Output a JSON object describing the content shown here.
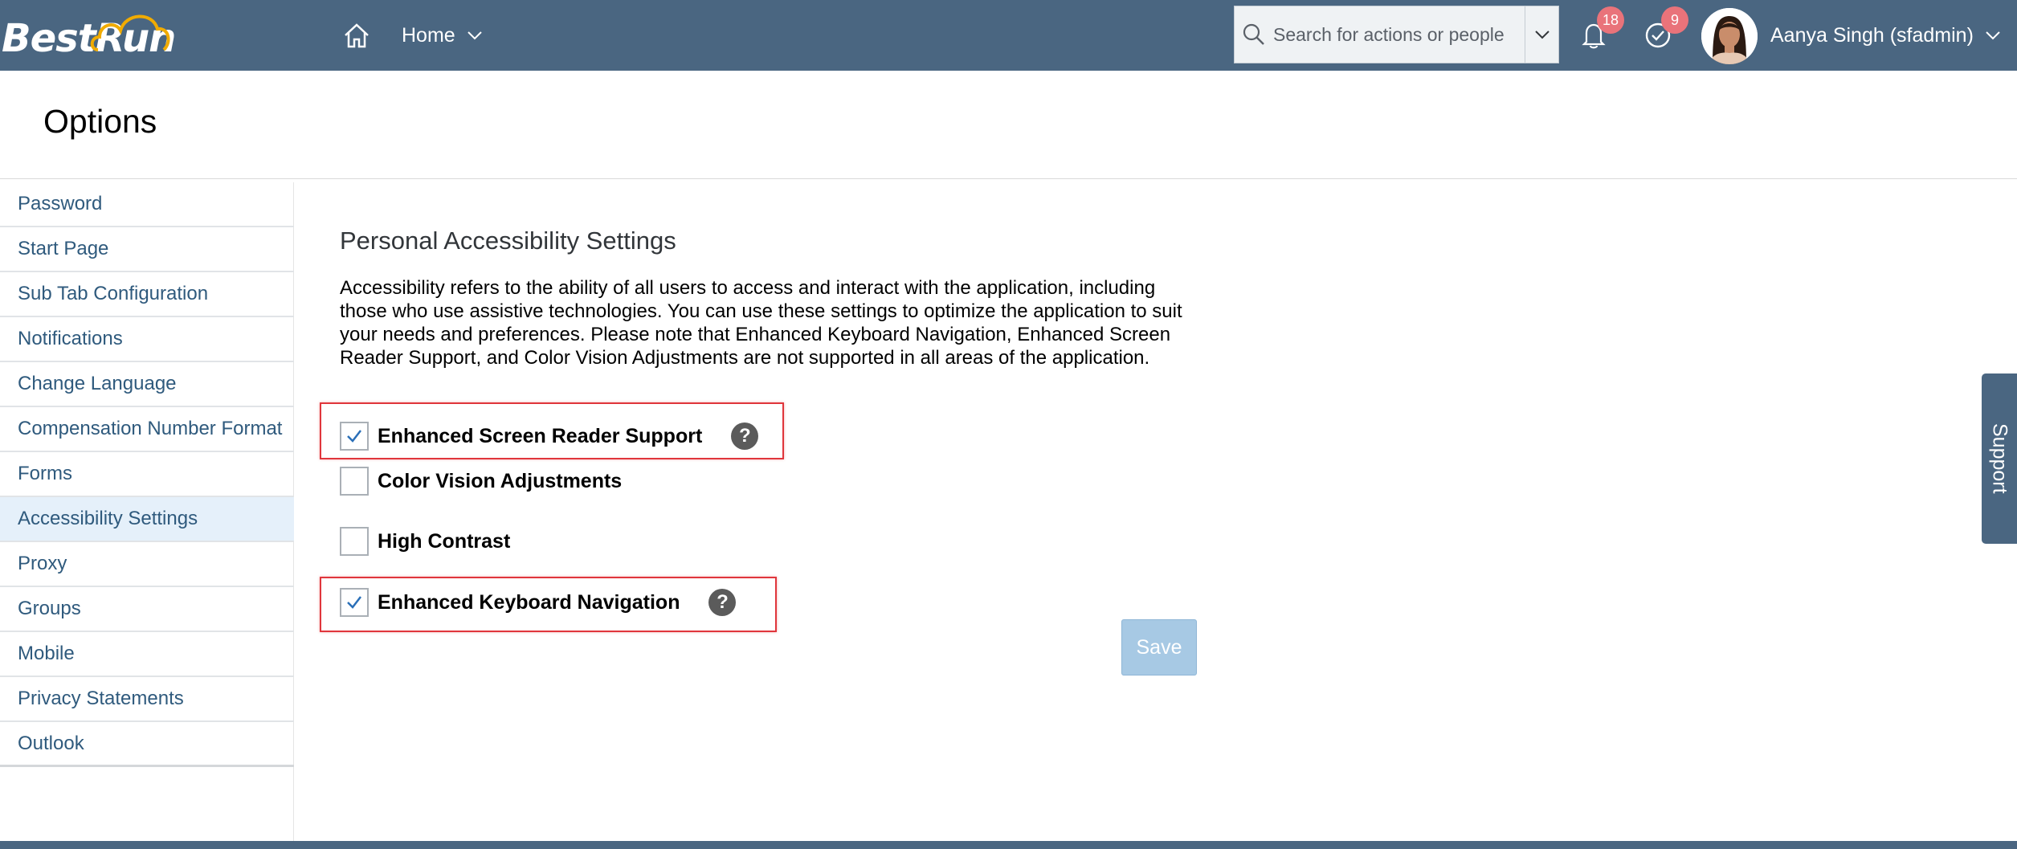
{
  "brand": {
    "logo_text": "BestRun"
  },
  "shellbar": {
    "home_label": "Home",
    "search": {
      "placeholder": "Search for actions or people"
    },
    "notifications": {
      "count": "18"
    },
    "tasks": {
      "count": "9"
    },
    "user": {
      "name": "Aanya Singh (sfadmin)"
    },
    "colors": {
      "bar": "#4a6681",
      "badge": "#e9737a"
    }
  },
  "page": {
    "title": "Options"
  },
  "sidebar": {
    "items": [
      {
        "label": "Password"
      },
      {
        "label": "Start Page"
      },
      {
        "label": "Sub Tab Configuration"
      },
      {
        "label": "Notifications"
      },
      {
        "label": "Change Language"
      },
      {
        "label": "Compensation Number Format"
      },
      {
        "label": "Forms"
      },
      {
        "label": "Accessibility Settings",
        "active": true
      },
      {
        "label": "Proxy"
      },
      {
        "label": "Groups"
      },
      {
        "label": "Mobile"
      },
      {
        "label": "Privacy Statements"
      },
      {
        "label": "Outlook"
      }
    ]
  },
  "main": {
    "section_title": "Personal Accessibility Settings",
    "description": "Accessibility refers to the ability of all users to access and interact with the application, including those who use assistive technologies. You can use these settings to optimize the application to suit your needs and preferences. Please note that Enhanced Keyboard Navigation, Enhanced Screen Reader Support, and Color Vision Adjustments are not supported in all areas of the application.",
    "options": [
      {
        "label": "Enhanced Screen Reader Support",
        "checked": true,
        "help": "?"
      },
      {
        "label": "Color Vision Adjustments",
        "checked": false
      },
      {
        "label": "High Contrast",
        "checked": false
      },
      {
        "label": "Enhanced Keyboard Navigation",
        "checked": true,
        "help": "?"
      }
    ],
    "save_label": "Save"
  },
  "support": {
    "label": "Support"
  }
}
